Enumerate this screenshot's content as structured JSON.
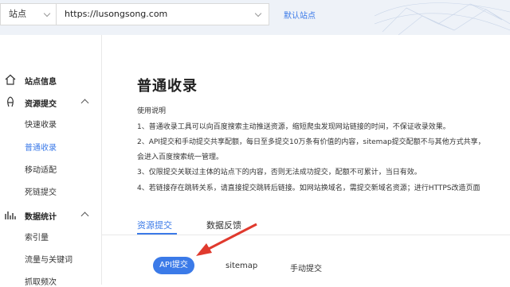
{
  "header": {
    "site_select": "站点",
    "url": "https://lusongsong.com",
    "default_site": "默认站点"
  },
  "sidebar": {
    "groups": [
      {
        "label": "站点信息",
        "icon": "home-icon",
        "items": []
      },
      {
        "label": "资源提交",
        "icon": "submit-icon",
        "expanded": true,
        "items": [
          "快速收录",
          "普通收录",
          "移动适配",
          "死链提交"
        ]
      },
      {
        "label": "数据统计",
        "icon": "stats-icon",
        "expanded": true,
        "items": [
          "索引量",
          "流量与关键词",
          "抓取频次"
        ]
      }
    ],
    "active_item": "普通收录"
  },
  "main": {
    "title": "普通收录",
    "usage_title": "使用说明",
    "usage_lines": [
      "1、普通收录工具可以向百度搜索主动推送资源，缩短爬虫发现网站链接的时间，不保证收录效果。",
      "2、API提交和手动提交共享配额，每日至多提交10万条有价值的内容，sitemap提交配额不与其他方式共享，",
      "会进入百度搜索统一管理。",
      "3、仅限提交关联过主体的站点下的内容，否则无法成功提交，配额不可累计，当日有效。",
      "4、若链接存在跳转关系，请直接提交跳转后链接。如网站换域名，需提交新域名资源；进行HTTPS改造页面"
    ],
    "tabs": [
      "资源提交",
      "数据反馈"
    ],
    "active_tab": "资源提交",
    "subtabs": [
      "API提交",
      "sitemap",
      "手动提交"
    ],
    "active_subtab": "API提交"
  },
  "colors": {
    "accent": "#3b7ae8",
    "arrow": "#e03a2e"
  }
}
